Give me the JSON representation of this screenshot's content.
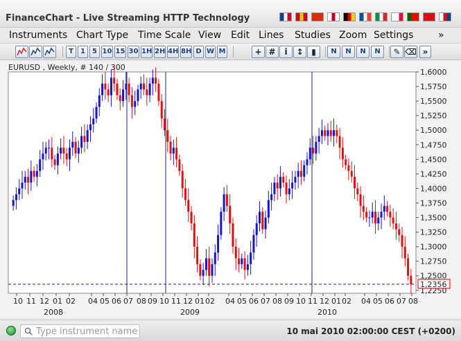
{
  "window": {
    "title": "FinanceChart - Live Streaming HTTP Technology"
  },
  "languages": [
    {
      "name": "english-flag",
      "colors": [
        "#1f3c8f",
        "#ffffff",
        "#c8102e"
      ]
    },
    {
      "name": "spanish-flag",
      "colors": [
        "#c60b1e",
        "#ffc400",
        "#c60b1e"
      ]
    },
    {
      "name": "chinese-flag",
      "colors": [
        "#de2910",
        "#de2910",
        "#de2910"
      ]
    },
    {
      "name": "japanese-flag",
      "colors": [
        "#ffffff",
        "#bc002d",
        "#ffffff"
      ]
    },
    {
      "name": "german-flag",
      "colors": [
        "#000000",
        "#dd0000",
        "#ffce00"
      ]
    },
    {
      "name": "french-flag",
      "colors": [
        "#0055a4",
        "#ffffff",
        "#ef4135"
      ]
    },
    {
      "name": "italian-flag",
      "colors": [
        "#009246",
        "#ffffff",
        "#ce2b37"
      ]
    },
    {
      "name": "polish-flag",
      "colors": [
        "#ffffff",
        "#ffffff",
        "#dc143c"
      ]
    },
    {
      "name": "portuguese-flag",
      "colors": [
        "#006600",
        "#ff0000",
        "#ff0000"
      ]
    },
    {
      "name": "turkish-flag",
      "colors": [
        "#e30a17",
        "#e30a17",
        "#e30a17"
      ]
    },
    {
      "name": "czech-flag",
      "colors": [
        "#ffffff",
        "#d7141a",
        "#11457e"
      ]
    }
  ],
  "menu": {
    "items": [
      "Instruments",
      "Chart Type",
      "Time Scale",
      "View",
      "Edit",
      "Lines",
      "Studies",
      "Zoom",
      "Settings"
    ],
    "overflow": "»"
  },
  "toolbar": {
    "chart_types": [
      "candlestick-icon",
      "bar-chart-icon",
      "line-chart-icon"
    ],
    "timeframes": [
      "T",
      "1",
      "5",
      "10",
      "15",
      "30",
      "1H",
      "2H",
      "4H",
      "8H",
      "D",
      "W",
      "M"
    ],
    "tools": [
      {
        "name": "crosshair-icon",
        "glyph": "+"
      },
      {
        "name": "grid-icon",
        "glyph": "#"
      },
      {
        "name": "info-icon",
        "glyph": "i"
      },
      {
        "name": "scale-icon",
        "glyph": "↕"
      },
      {
        "name": "volume-icon",
        "glyph": "▮"
      }
    ],
    "drawing": [
      {
        "name": "trend-line-icon",
        "glyph": "N"
      },
      {
        "name": "channel-icon",
        "glyph": "N"
      },
      {
        "name": "fibonacci-icon",
        "glyph": "N"
      },
      {
        "name": "gann-icon",
        "glyph": "N"
      }
    ],
    "edit": [
      {
        "name": "edit-line-icon",
        "glyph": "✎"
      },
      {
        "name": "eraser-icon",
        "glyph": "⌫"
      }
    ],
    "overflow": "»"
  },
  "chart": {
    "instrument_label": "EURUSD , Weekly, # 140 / 300",
    "last_price_label": "1,2356",
    "colors": {
      "up": "#1515cc",
      "down": "#dd1111",
      "vline": "#1a1a8c",
      "price_line": "#1a1a8c",
      "label_border": "#cc0000"
    }
  },
  "chart_data": {
    "type": "candlestick",
    "ylim": [
      1.22,
      1.6
    ],
    "yticks": [
      "1,6000",
      "1,5750",
      "1,5500",
      "1,5250",
      "1,5000",
      "1,4750",
      "1,4500",
      "1,4250",
      "1,4000",
      "1,3750",
      "1,3500",
      "1,3250",
      "1,3000",
      "1,2750",
      "1,2500",
      "1,2250"
    ],
    "ytick_values": [
      1.6,
      1.575,
      1.55,
      1.525,
      1.5,
      1.475,
      1.45,
      1.425,
      1.4,
      1.375,
      1.35,
      1.325,
      1.3,
      1.275,
      1.25,
      1.225
    ],
    "xticks": [
      "10",
      "11",
      "12",
      "01",
      "02",
      "04",
      "05",
      "06",
      "07",
      "08",
      "09",
      "10",
      "11",
      "12",
      "01",
      "02",
      "04",
      "05",
      "06",
      "07",
      "08",
      "09",
      "10",
      "11",
      "12",
      "01",
      "02",
      "04",
      "05",
      "06",
      "07",
      "08"
    ],
    "years": [
      "2008",
      "2009",
      "2010"
    ],
    "last_price": 1.2356,
    "closes": [
      1.38,
      1.39,
      1.4,
      1.41,
      1.42,
      1.41,
      1.43,
      1.42,
      1.43,
      1.45,
      1.46,
      1.47,
      1.47,
      1.45,
      1.44,
      1.46,
      1.47,
      1.46,
      1.45,
      1.47,
      1.48,
      1.46,
      1.47,
      1.49,
      1.48,
      1.5,
      1.51,
      1.52,
      1.54,
      1.56,
      1.58,
      1.57,
      1.56,
      1.59,
      1.58,
      1.56,
      1.55,
      1.57,
      1.58,
      1.56,
      1.54,
      1.55,
      1.57,
      1.58,
      1.57,
      1.56,
      1.58,
      1.59,
      1.58,
      1.55,
      1.52,
      1.5,
      1.48,
      1.46,
      1.47,
      1.45,
      1.43,
      1.4,
      1.38,
      1.36,
      1.34,
      1.3,
      1.27,
      1.25,
      1.26,
      1.28,
      1.25,
      1.27,
      1.29,
      1.32,
      1.36,
      1.39,
      1.37,
      1.34,
      1.3,
      1.28,
      1.27,
      1.28,
      1.26,
      1.27,
      1.29,
      1.32,
      1.34,
      1.36,
      1.33,
      1.35,
      1.38,
      1.39,
      1.41,
      1.4,
      1.42,
      1.41,
      1.39,
      1.4,
      1.41,
      1.42,
      1.43,
      1.42,
      1.44,
      1.45,
      1.47,
      1.46,
      1.48,
      1.49,
      1.5,
      1.49,
      1.5,
      1.49,
      1.5,
      1.49,
      1.47,
      1.45,
      1.44,
      1.43,
      1.42,
      1.4,
      1.39,
      1.37,
      1.36,
      1.35,
      1.35,
      1.36,
      1.34,
      1.35,
      1.36,
      1.37,
      1.36,
      1.35,
      1.34,
      1.33,
      1.32,
      1.3,
      1.28,
      1.25,
      1.2356
    ]
  },
  "status": {
    "search_placeholder": "Type instrument name",
    "datetime": "10 mai 2010 02:00:00  CEST (+0200)"
  }
}
